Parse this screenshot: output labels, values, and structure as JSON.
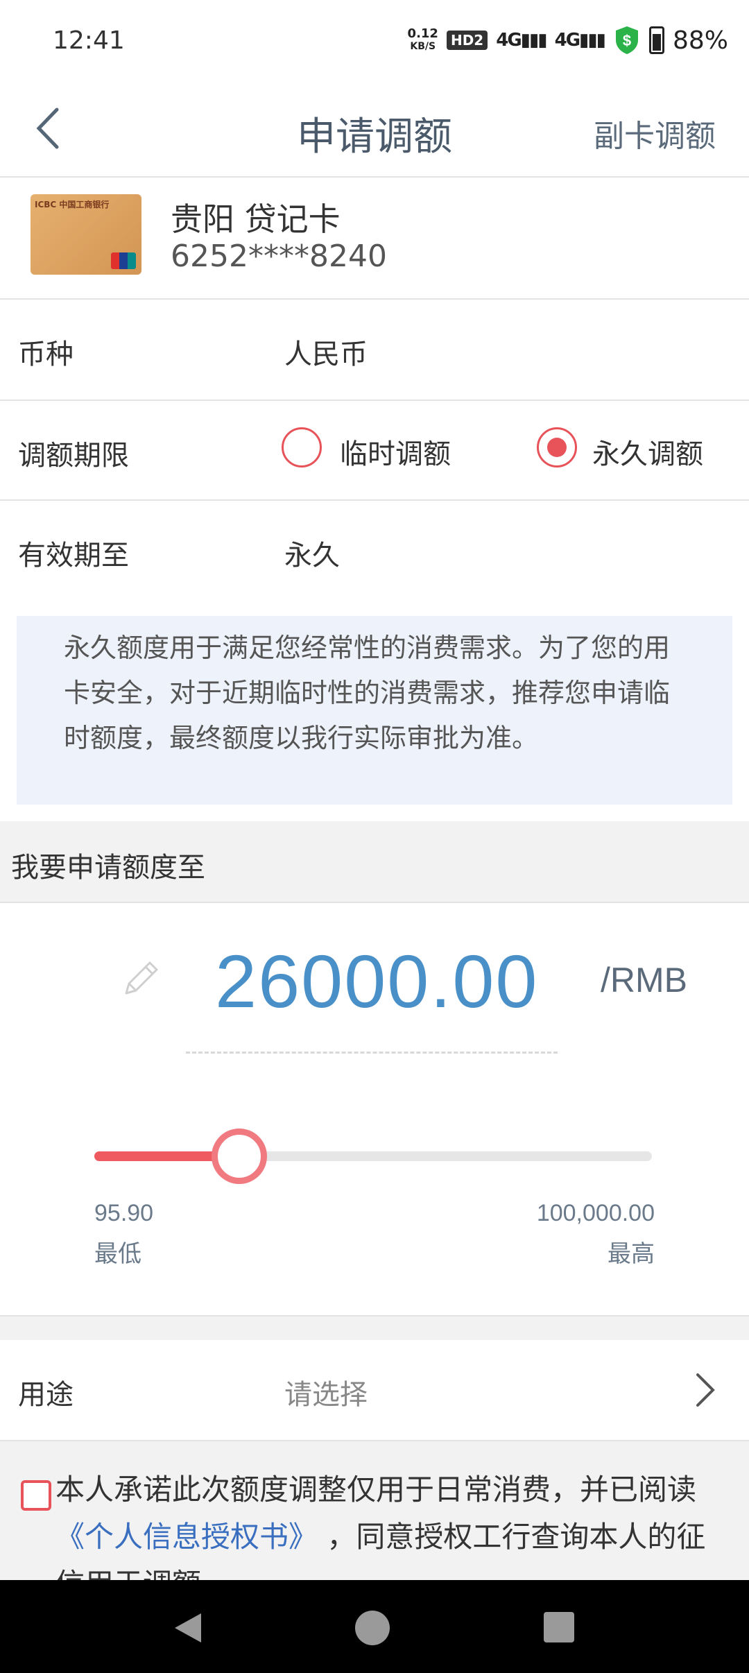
{
  "status": {
    "time": "12:41",
    "speed_value": "0.12",
    "speed_unit": "KB/S",
    "hd": "HD2",
    "network1": "4G",
    "network2": "4G",
    "battery": "88%"
  },
  "nav": {
    "title": "申请调额",
    "right_action": "副卡调额"
  },
  "card": {
    "name": "贵阳 贷记卡",
    "number": "6252****8240",
    "bank_mark": "ICBC 中国工商银行"
  },
  "currency": {
    "label": "币种",
    "value": "人民币"
  },
  "term": {
    "label": "调额期限",
    "options": [
      "临时调额",
      "永久调额"
    ],
    "selected": "永久调额"
  },
  "expiry": {
    "label": "有效期至",
    "value": "永久"
  },
  "notice": "永久额度用于满足您经常性的消费需求。为了您的用卡安全，对于近期临时性的消费需求，推荐您申请临时额度，最终额度以我行实际审批为准。",
  "apply": {
    "section_title": "我要申请额度至",
    "amount": "26000.00",
    "unit": "/RMB",
    "min_value": "95.90",
    "min_label": "最低",
    "max_value": "100,000.00",
    "max_label": "最高",
    "slider_fraction": 0.26
  },
  "purpose": {
    "label": "用途",
    "placeholder": "请选择"
  },
  "agreement": {
    "prefix": "本人承诺此次额度调整仅用于日常消费，并已阅读",
    "link": "《个人信息授权书》",
    "suffix": "，同意授权工行查询本人的征信用于调额"
  },
  "colors": {
    "accent": "#e8535a",
    "amount": "#4a90c8",
    "link": "#3a6fc0"
  }
}
